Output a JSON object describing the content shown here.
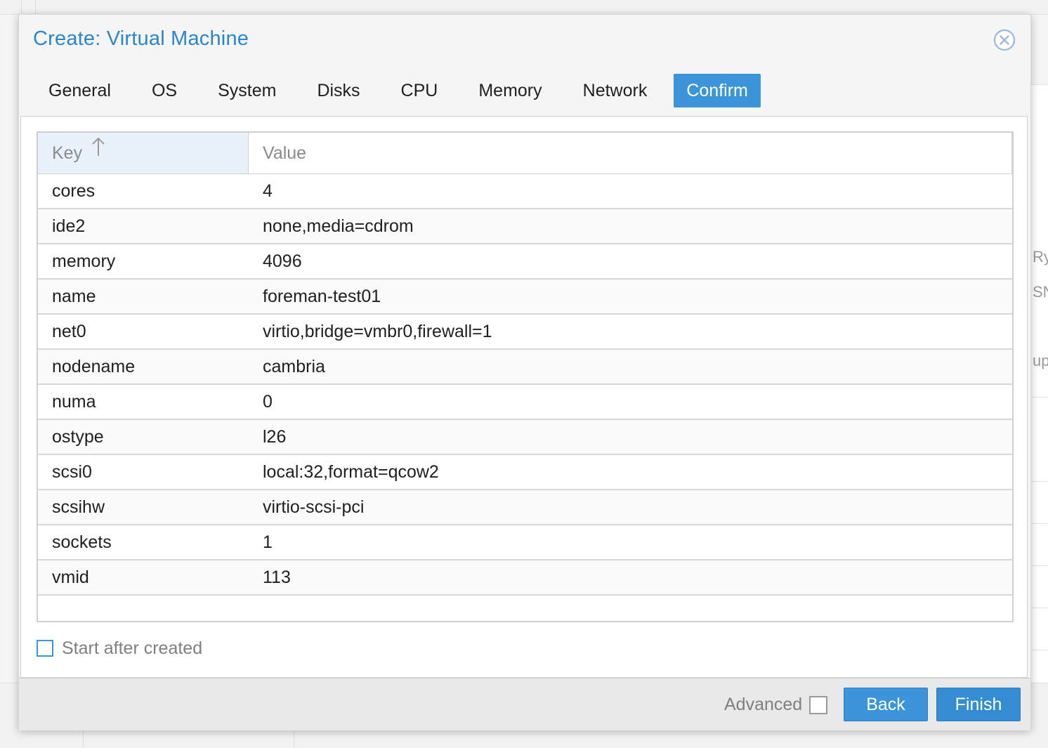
{
  "background": {
    "fragments": [
      "Ry",
      "SN",
      "up"
    ]
  },
  "dialog": {
    "title": "Create: Virtual Machine",
    "close_icon": "close-circle-icon",
    "accent_color": "#2d85ca"
  },
  "tabs": [
    {
      "label": "General",
      "active": false
    },
    {
      "label": "OS",
      "active": false
    },
    {
      "label": "System",
      "active": false
    },
    {
      "label": "Disks",
      "active": false
    },
    {
      "label": "CPU",
      "active": false
    },
    {
      "label": "Memory",
      "active": false
    },
    {
      "label": "Network",
      "active": false
    },
    {
      "label": "Confirm",
      "active": true
    }
  ],
  "grid": {
    "columns": {
      "key": "Key",
      "value": "Value",
      "sort_icon": "sort-ascending-icon"
    },
    "rows": [
      {
        "key": "cores",
        "value": "4"
      },
      {
        "key": "ide2",
        "value": "none,media=cdrom"
      },
      {
        "key": "memory",
        "value": "4096"
      },
      {
        "key": "name",
        "value": "foreman-test01"
      },
      {
        "key": "net0",
        "value": "virtio,bridge=vmbr0,firewall=1"
      },
      {
        "key": "nodename",
        "value": "cambria"
      },
      {
        "key": "numa",
        "value": "0"
      },
      {
        "key": "ostype",
        "value": "l26"
      },
      {
        "key": "scsi0",
        "value": "local:32,format=qcow2"
      },
      {
        "key": "scsihw",
        "value": "virtio-scsi-pci"
      },
      {
        "key": "sockets",
        "value": "1"
      },
      {
        "key": "vmid",
        "value": "113"
      }
    ]
  },
  "options": {
    "start_after_created": {
      "label": "Start after created",
      "checked": false
    }
  },
  "footer": {
    "advanced": {
      "label": "Advanced",
      "checked": false
    },
    "back_label": "Back",
    "finish_label": "Finish"
  }
}
